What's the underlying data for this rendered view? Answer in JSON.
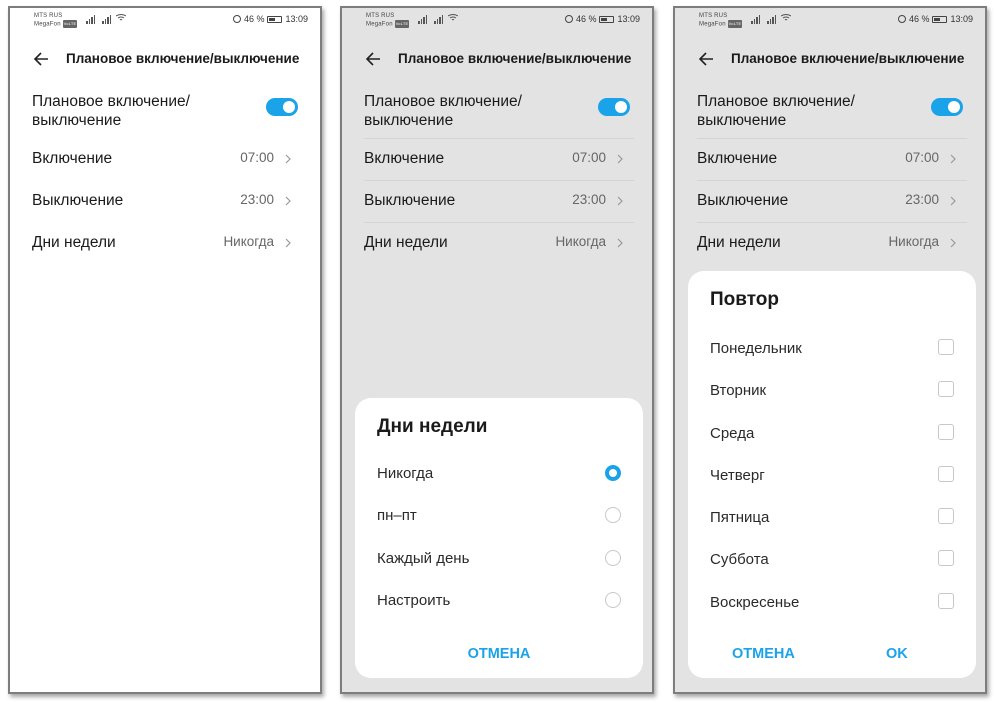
{
  "status": {
    "carrier1": "MTS RUS",
    "carrier2": "MegaFon",
    "volte": "VoLTE",
    "battery": "46 %",
    "time": "13:09"
  },
  "header": {
    "title": "Плановое включение/выключение"
  },
  "settings": {
    "toggle_label": "Плановое включение/ выключение",
    "toggle_state": "on",
    "on_label": "Включение",
    "on_value": "07:00",
    "off_label": "Выключение",
    "off_value": "23:00",
    "days_label": "Дни недели",
    "days_value": "Никогда"
  },
  "days_dialog": {
    "title": "Дни недели",
    "options": [
      "Никогда",
      "пн–пт",
      "Каждый день",
      "Настроить"
    ],
    "selected_index": 0,
    "cancel": "ОТМЕНА"
  },
  "repeat_dialog": {
    "title": "Повтор",
    "days": [
      "Понедельник",
      "Вторник",
      "Среда",
      "Четверг",
      "Пятница",
      "Суббота",
      "Воскресенье"
    ],
    "cancel": "ОТМЕНА",
    "ok": "OK"
  },
  "colors": {
    "accent": "#1aa3e8",
    "dim_background": "#e3e3e3"
  }
}
